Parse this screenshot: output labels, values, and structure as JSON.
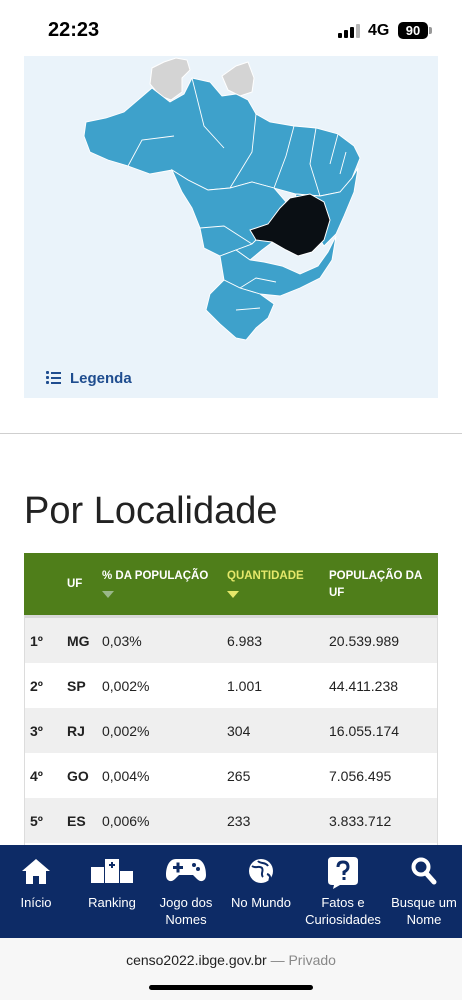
{
  "status_bar": {
    "time": "22:23",
    "network": "4G",
    "battery": "90"
  },
  "map": {
    "legend_label": "Legenda",
    "highlight_color": "#0a0f14",
    "state_color": "#3ea1cb",
    "neighbor_color": "#d4d4d4"
  },
  "section_title": "Por Localidade",
  "table": {
    "headers": {
      "uf": "UF",
      "pct": "% DA POPULAÇÃO",
      "qty": "QUANTIDADE",
      "pop": "POPULAÇÃO DA UF"
    },
    "header_color": "#4f7e1a",
    "rows": [
      {
        "rank": "1º",
        "uf": "MG",
        "pct": "0,03%",
        "qty": "6.983",
        "pop": "20.539.989"
      },
      {
        "rank": "2º",
        "uf": "SP",
        "pct": "0,002%",
        "qty": "1.001",
        "pop": "44.411.238"
      },
      {
        "rank": "3º",
        "uf": "RJ",
        "pct": "0,002%",
        "qty": "304",
        "pop": "16.055.174"
      },
      {
        "rank": "4º",
        "uf": "GO",
        "pct": "0,004%",
        "qty": "265",
        "pop": "7.056.495"
      },
      {
        "rank": "5º",
        "uf": "ES",
        "pct": "0,006%",
        "qty": "233",
        "pop": "3.833.712"
      }
    ]
  },
  "bottom_nav": {
    "items": [
      {
        "label": "Início",
        "icon": "home-icon"
      },
      {
        "label": "Ranking",
        "icon": "podium-icon"
      },
      {
        "label": "Jogo dos Nomes",
        "icon": "gamepad-icon"
      },
      {
        "label": "No Mundo",
        "icon": "globe-icon"
      },
      {
        "label": "Fatos e Curiosidades",
        "icon": "question-icon"
      },
      {
        "label": "Busque um Nome",
        "icon": "search-icon"
      }
    ]
  },
  "browser": {
    "domain": "censo2022.ibge.gov.br",
    "separator": "—",
    "mode": "Privado"
  }
}
